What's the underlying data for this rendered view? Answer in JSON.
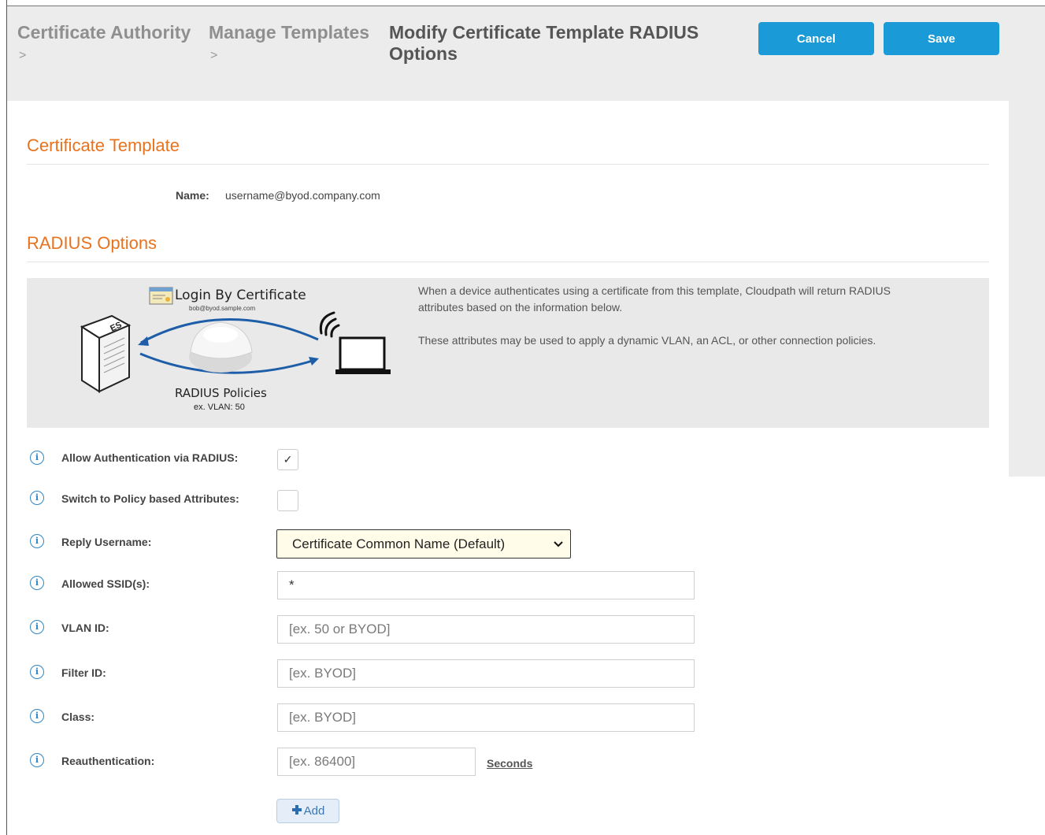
{
  "breadcrumb": {
    "items": [
      {
        "label": "Certificate Authority",
        "separator": ">"
      },
      {
        "label": "Manage Templates",
        "separator": ">"
      }
    ],
    "current": "Modify Certificate Template RADIUS Options"
  },
  "actions": {
    "cancel_label": "Cancel",
    "save_label": "Save"
  },
  "certificate_template": {
    "heading": "Certificate Template",
    "name_label": "Name:",
    "name_value": "username@byod.company.com"
  },
  "radius_options": {
    "heading": "RADIUS Options",
    "diagram": {
      "login_title": "Login By Certificate",
      "login_subtitle": "bob@byod.sample.com",
      "server_label": "ES",
      "policies_title": "RADIUS Policies",
      "policies_subtitle": "ex. VLAN: 50"
    },
    "description_1": "When a device authenticates using a certificate from this template, Cloudpath will return RADIUS attributes based on the information below.",
    "description_2": "These attributes may be used to apply a dynamic VLAN, an ACL, or other connection policies."
  },
  "form": {
    "allow_auth": {
      "label": "Allow Authentication via RADIUS:",
      "checked": true,
      "mark": "✓"
    },
    "switch_policy": {
      "label": "Switch to Policy based Attributes:",
      "checked": false
    },
    "reply_username": {
      "label": "Reply Username:",
      "selected": "Certificate Common Name (Default)"
    },
    "allowed_ssids": {
      "label": "Allowed SSID(s):",
      "value": "*"
    },
    "vlan_id": {
      "label": "VLAN ID:",
      "placeholder": "[ex. 50 or BYOD]"
    },
    "filter_id": {
      "label": "Filter ID:",
      "placeholder": "[ex. BYOD]"
    },
    "class": {
      "label": "Class:",
      "placeholder": "[ex. BYOD]"
    },
    "reauthentication": {
      "label": "Reauthentication:",
      "placeholder": "[ex. 86400]",
      "unit": "Seconds"
    },
    "add_label": "Add",
    "info_glyph": "i"
  },
  "colors": {
    "accent_orange": "#e8731e",
    "button_blue": "#1a9ad6",
    "info_blue": "#2e86c8",
    "select_bg": "#fffcea"
  },
  "icons": {
    "info": "info-circle-icon",
    "dropdown": "chevron-down-icon",
    "add": "plus-icon",
    "certificate": "certificate-icon",
    "server": "server-icon",
    "access_point": "access-point-icon",
    "wifi": "wifi-icon",
    "laptop": "laptop-icon"
  }
}
